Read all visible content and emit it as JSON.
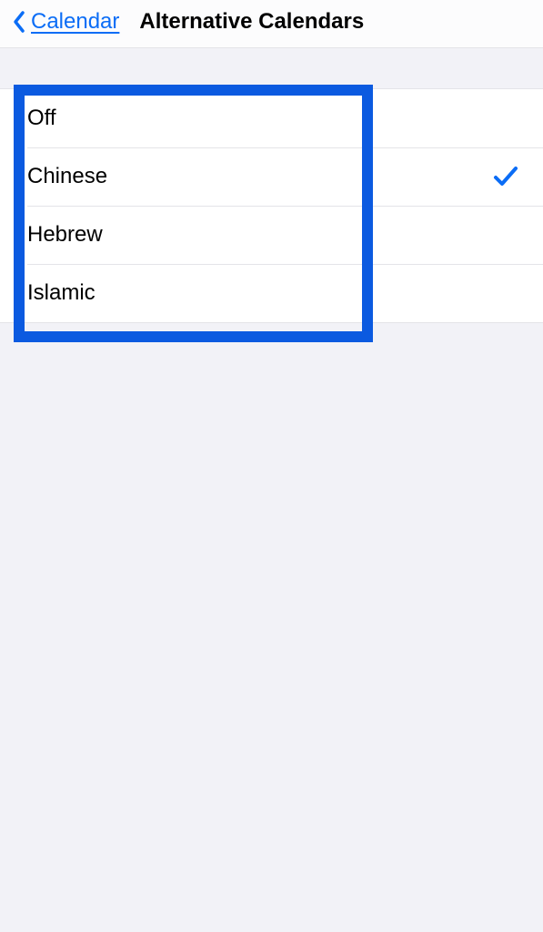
{
  "header": {
    "back_label": "Calendar",
    "title": "Alternative Calendars"
  },
  "options": [
    {
      "label": "Off",
      "selected": false
    },
    {
      "label": "Chinese",
      "selected": true
    },
    {
      "label": "Hebrew",
      "selected": false
    },
    {
      "label": "Islamic",
      "selected": false
    }
  ],
  "colors": {
    "accent": "#0b6df6",
    "highlight_border": "#0b5ae0"
  }
}
